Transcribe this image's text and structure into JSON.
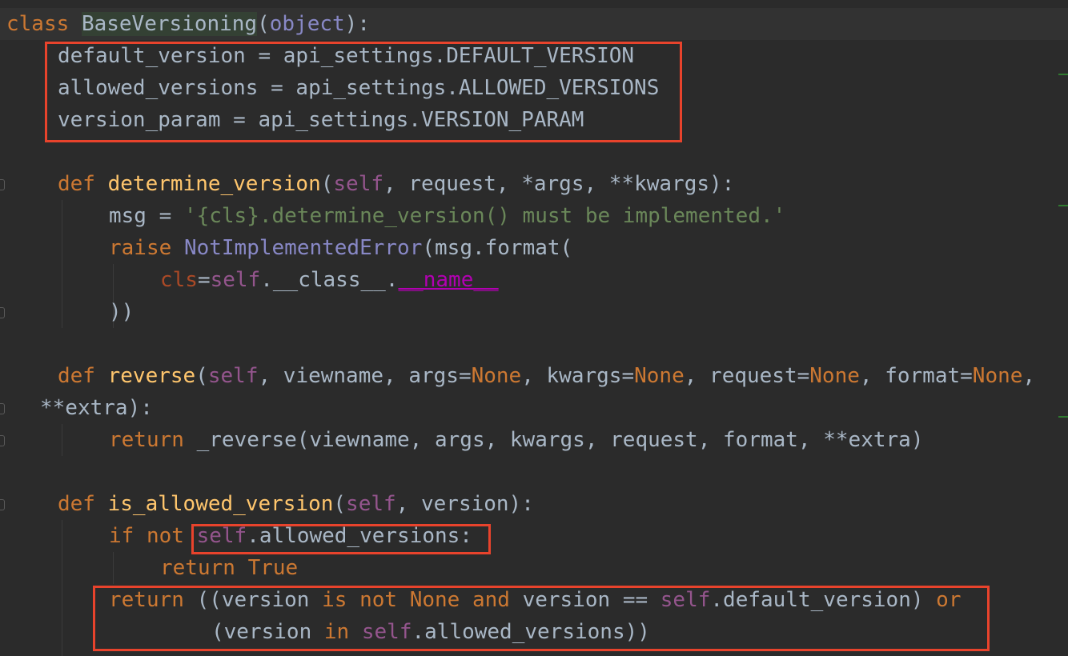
{
  "code": {
    "class_kw": "class",
    "class_name": "BaseVersioning",
    "class_base": "object",
    "l1": "default_version = api_settings.DEFAULT_VERSION",
    "l2": "allowed_versions = api_settings.ALLOWED_VERSIONS",
    "l3": "version_param = api_settings.VERSION_PARAM",
    "dv_def": "def",
    "dv_name": "determine_version",
    "dv_self": "self",
    "dv_rest": ", request, *args, **kwargs):",
    "msg_lhs": "msg = ",
    "msg_str": "'{cls}.determine_version() must be implemented.'",
    "raise_kw": "raise",
    "raise_cls": "NotImplementedError",
    "raise_rest": "(msg.format(",
    "cls_param": "cls",
    "cls_eq": "=",
    "cls_self": "self",
    "cls_mid": ".__class__.",
    "cls_magic": "__name__",
    "close_paren": "))",
    "rev_def": "def",
    "rev_name": "reverse",
    "rev_self": "self",
    "rev_a": ", viewname, args=",
    "none": "None",
    "rev_b": ", kwargs=",
    "rev_c": ", request=",
    "rev_d": ", format=",
    "rev_e": ",",
    "rev_extra": "**extra):",
    "ret_kw": "return",
    "ret_rest": " _reverse(viewname, args, kwargs, request, format, **extra)",
    "ia_def": "def",
    "ia_name": "is_allowed_version",
    "ia_self": "self",
    "ia_rest": ", version):",
    "if_kw": "if not",
    "if_self": "self",
    "if_rest": ".allowed_versions:",
    "rt_kw": "return",
    "rt_true": "True",
    "r1_kw": "return",
    "r1_a": " ((version ",
    "r1_is": "is not",
    "r1_none": "None",
    "r1_and": "and",
    "r1_b": " version == ",
    "r1_self": "self",
    "r1_c": ".default_version) ",
    "r1_or": "or",
    "r2_a": "(version ",
    "r2_in": "in",
    "r2_self": "self",
    "r2_b": ".allowed_versions))"
  },
  "colors": {
    "background": "#2b2b2b",
    "keyword": "#cc7832",
    "self": "#94558d",
    "function": "#ffc66d",
    "string": "#6a8759",
    "builtin_class": "#8888c6",
    "highlight_box": "#e8432c"
  }
}
